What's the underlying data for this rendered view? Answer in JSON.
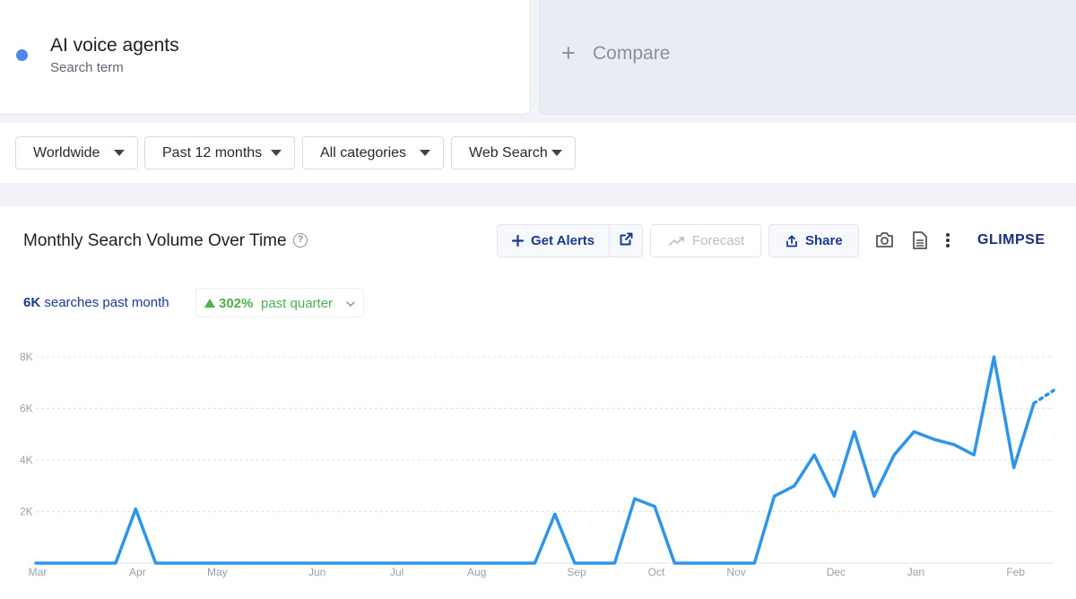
{
  "term": {
    "name": "AI voice agents",
    "subtitle": "Search term",
    "dot_color": "#4d86ee"
  },
  "compare": {
    "icon": "plus-icon",
    "label": "Compare"
  },
  "filters": [
    {
      "label": "Worldwide"
    },
    {
      "label": "Past 12 months"
    },
    {
      "label": "All categories"
    },
    {
      "label": "Web Search"
    }
  ],
  "chart_header": {
    "title": "Monthly Search Volume Over Time",
    "help_icon": "help-circle-icon",
    "buttons": {
      "alerts": "Get Alerts",
      "forecast": "Forecast",
      "share": "Share"
    },
    "icons": [
      "plus-icon",
      "external-link-icon",
      "trend-icon",
      "share-icon",
      "camera-icon",
      "document-icon",
      "more-vertical-icon"
    ],
    "brand": "GLIMPSE"
  },
  "stats": {
    "value": "6K",
    "value_suffix": "searches past month",
    "change": "302%",
    "change_suffix": "past quarter",
    "change_color": "#4caf50"
  },
  "chart_data": {
    "type": "line",
    "title": "",
    "xlabel": "",
    "ylabel": "",
    "x_ticks": [
      "Mar",
      "Apr",
      "May",
      "Jun",
      "Jul",
      "Aug",
      "Sep",
      "Oct",
      "Nov",
      "Dec",
      "Jan",
      "Feb"
    ],
    "y_ticks": [
      "2K",
      "4K",
      "6K",
      "8K"
    ],
    "ylim": [
      0,
      8000
    ],
    "grid": true,
    "series_color": "#2f95e8",
    "values": [
      0,
      0,
      0,
      0,
      0,
      2100,
      0,
      0,
      0,
      0,
      0,
      0,
      0,
      0,
      0,
      0,
      0,
      0,
      0,
      0,
      0,
      0,
      0,
      0,
      0,
      0,
      1900,
      0,
      0,
      0,
      2500,
      2200,
      0,
      0,
      0,
      0,
      0,
      2600,
      3000,
      4200,
      2600,
      5100,
      2600,
      4200,
      5100,
      4800,
      4600,
      4200,
      8000,
      3700,
      6200
    ],
    "projected": [
      6200,
      6700
    ]
  }
}
